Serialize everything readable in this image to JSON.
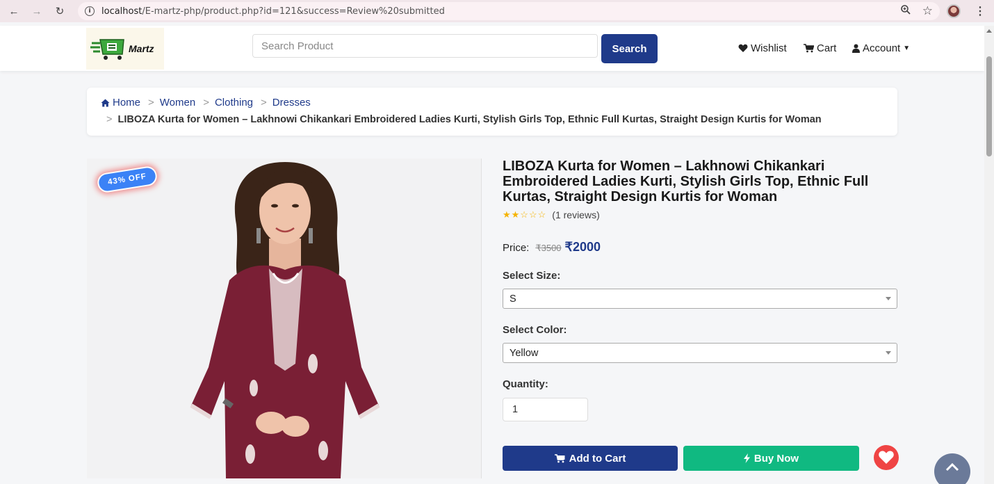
{
  "browser": {
    "url_host": "localhost",
    "url_path": "/E-martz-php/product.php?id=121&success=Review%20submitted"
  },
  "header": {
    "logo_text": "Martz",
    "search_placeholder": "Search Product",
    "search_button": "Search",
    "nav": {
      "wishlist": "Wishlist",
      "cart": "Cart",
      "account": "Account"
    }
  },
  "breadcrumb": {
    "items": [
      "Home",
      "Women",
      "Clothing",
      "Dresses"
    ],
    "current": "LIBOZA Kurta for Women – Lakhnowi Chikankari Embroidered Ladies Kurti, Stylish Girls Top, Ethnic Full Kurtas, Straight Design Kurtis for Woman",
    "separator": ">"
  },
  "product": {
    "discount_badge": "43% OFF",
    "title": "LIBOZA Kurta for Women – Lakhnowi Chikankari Embroidered Ladies Kurti, Stylish Girls Top, Ethnic Full Kurtas, Straight Design Kurtis for Woman",
    "rating_stars": "★★☆☆☆",
    "rating_value": 2,
    "reviews": "(1 reviews)",
    "price_label": "Price:",
    "old_price": "₹3500",
    "new_price": "₹2000",
    "size_label": "Select Size:",
    "size_value": "S",
    "color_label": "Select Color:",
    "color_value": "Yellow",
    "qty_label": "Quantity:",
    "qty_value": "1",
    "add_to_cart": "Add to Cart",
    "buy_now": "Buy Now"
  },
  "colors": {
    "primary": "#1f3a8a",
    "success": "#10b981",
    "danger": "#ef4444",
    "badge": "#3b82f6",
    "kurta": "#7a1f35"
  }
}
